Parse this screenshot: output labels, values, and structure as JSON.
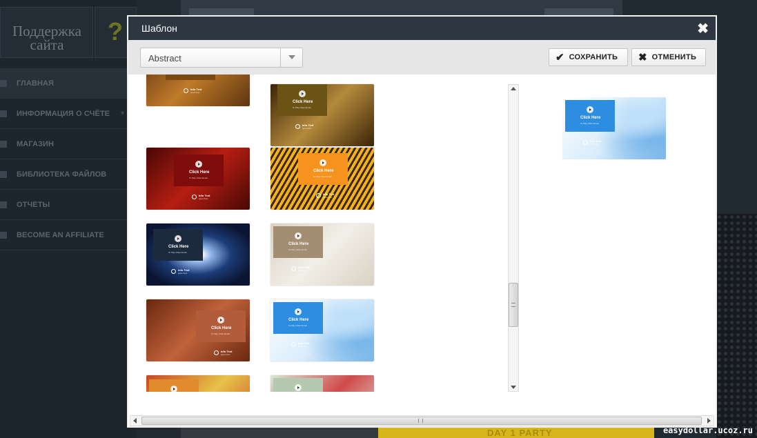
{
  "sidebar": {
    "support_title": "Поддержка сайта",
    "help_symbol": "?",
    "items": [
      {
        "label": "ГЛАВНАЯ",
        "icon": "home-icon"
      },
      {
        "label": "ИНФОРМАЦИЯ О СЧЁТЕ",
        "icon": "user-icon"
      },
      {
        "label": "МАГАЗИН",
        "icon": "cart-icon"
      },
      {
        "label": "БИБЛИОТЕКА ФАЙЛОВ",
        "icon": "folder-icon"
      },
      {
        "label": "ОТЧЕТЫ",
        "icon": "chart-icon"
      },
      {
        "label": "BECOME AN AFFILIATE",
        "icon": "user-icon"
      }
    ]
  },
  "background": {
    "banner_text": "DAY 1 PARTY",
    "watermark": "easydollar.ucoz.ru"
  },
  "modal": {
    "title": "Шаблон",
    "close_symbol": "✖",
    "category_select": {
      "value": "Abstract"
    },
    "save_button": {
      "label": "СОХРАНИТЬ",
      "icon": "check-icon",
      "glyph": "✔"
    },
    "cancel_button": {
      "label": "ОТМЕНИТЬ",
      "icon": "close-icon",
      "glyph": "✖"
    }
  },
  "template_card_text": {
    "click_here": "Click Here",
    "play_sub": "To Play Video Email",
    "info_text": "Info Text",
    "info_sub": "goes here"
  },
  "templates": [
    {
      "name": "sand-dunes",
      "colors": [
        "#5c3510",
        "#c07a2a"
      ],
      "box": "#7a4a12"
    },
    {
      "name": "wood-grain",
      "colors": [
        "#3b2408",
        "#b48a3c"
      ],
      "box": "#6b5316"
    },
    {
      "name": "red-crumple",
      "colors": [
        "#4a0706",
        "#b61e12"
      ],
      "box": "#7d0c0a"
    },
    {
      "name": "gold-stripes",
      "colors": [
        "#5a3a06",
        "#f1b21e"
      ],
      "box": "#f5931e"
    },
    {
      "name": "blue-burst",
      "colors": [
        "#0b1a36",
        "#7fa9e0"
      ],
      "box": "#1c2a3e"
    },
    {
      "name": "cracked-plaster",
      "colors": [
        "#d9d2c4",
        "#f2efe8"
      ],
      "box": "#a38d73"
    },
    {
      "name": "red-swirls",
      "colors": [
        "#6a2810",
        "#c0623a"
      ],
      "box": "#b25c3c"
    },
    {
      "name": "blue-waves",
      "colors": [
        "#ffffff",
        "#7ab7ea"
      ],
      "box": "#2d8de0"
    },
    {
      "name": "paper-folds",
      "colors": [
        "#c74720",
        "#e7c24a"
      ],
      "box": "#e18b2e"
    },
    {
      "name": "rainbow-spiral",
      "colors": [
        "#dbe6d8",
        "#d04a4a"
      ],
      "box": "#b5c8b0"
    }
  ],
  "selected_preview": {
    "name": "blue-waves",
    "colors": [
      "#ffffff",
      "#7ab7ea"
    ],
    "box": "#2d8de0"
  }
}
